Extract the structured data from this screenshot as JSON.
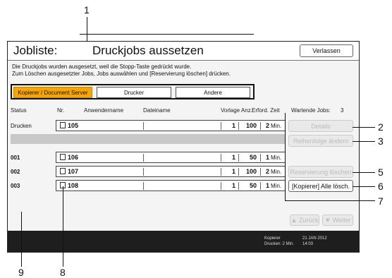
{
  "window": {
    "title": "Jobliste:",
    "subtitle": "Druckjobs aussetzen",
    "close_button": "Verlassen"
  },
  "message": {
    "line1": "Die Druckjobs wurden ausgesetzt, weil die Stopp-Taste gedrückt wurde.",
    "line2": "Zum Löschen ausgesetzter Jobs, Jobs auswählen und [Reservierung löschen] drücken."
  },
  "tabs": [
    {
      "label": "Kopierer / Document Server",
      "active": true
    },
    {
      "label": "Drucker",
      "active": false
    },
    {
      "label": "Andere",
      "active": false
    }
  ],
  "columns": {
    "status": "Status",
    "nr": "Nr.",
    "user": "Anwendername",
    "file": "Dateiname",
    "count": "Vorlage Anz.",
    "time": "Erford. Zeit",
    "waiting_label": "Wartende Jobs:",
    "waiting_value": "3"
  },
  "jobs": [
    {
      "status": "Drucken",
      "nr": "105",
      "originals": "1",
      "copies": "100",
      "time": "2",
      "unit": "Min."
    },
    {
      "status": "001",
      "nr": "106",
      "originals": "1",
      "copies": "50",
      "time": "1",
      "unit": "Min."
    },
    {
      "status": "002",
      "nr": "107",
      "originals": "1",
      "copies": "100",
      "time": "2",
      "unit": "Min."
    },
    {
      "status": "003",
      "nr": "108",
      "originals": "1",
      "copies": "50",
      "time": "1",
      "unit": "Min."
    }
  ],
  "side_buttons": {
    "details": "Details",
    "reorder": "Reihenfolge ändern",
    "delete_reservation": "Reservierung löschen",
    "delete_all": "[Kopierer] Alle lösch.",
    "prev": "▲ Zurück",
    "next": "▼ Weiter"
  },
  "footer": {
    "line1": "Kopierer",
    "line2": "Drucken: 2 Min.",
    "date": "21 JAN 2012",
    "time": "14:03"
  },
  "callouts": [
    "1",
    "2",
    "3",
    "5",
    "6",
    "7",
    "8",
    "9"
  ]
}
